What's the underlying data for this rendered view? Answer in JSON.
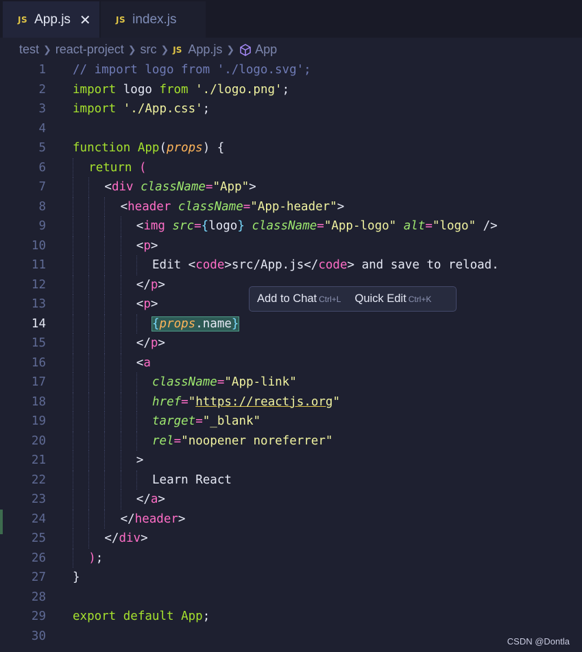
{
  "tabs": [
    {
      "icon": "JS",
      "label": "App.js",
      "active": true,
      "close": "✕"
    },
    {
      "icon": "JS",
      "label": "index.js",
      "active": false
    }
  ],
  "breadcrumb": {
    "items": [
      "test",
      "react-project",
      "src",
      "App.js",
      "App"
    ],
    "file_icon": "JS",
    "symbol_icon": "cube-icon"
  },
  "editor": {
    "current_line": 14,
    "modified_lines": [
      24
    ],
    "lines": [
      {
        "n": 1,
        "indent": 0,
        "tokens": [
          [
            "cm",
            "// import logo from './logo.svg';"
          ]
        ]
      },
      {
        "n": 2,
        "indent": 0,
        "tokens": [
          [
            "kw",
            "import"
          ],
          [
            "punc",
            " logo "
          ],
          [
            "kw",
            "from"
          ],
          [
            "punc",
            " "
          ],
          [
            "str",
            "'./logo.png'"
          ],
          [
            "punc",
            ";"
          ]
        ]
      },
      {
        "n": 3,
        "indent": 0,
        "tokens": [
          [
            "kw",
            "import"
          ],
          [
            "punc",
            " "
          ],
          [
            "str",
            "'./App.css'"
          ],
          [
            "punc",
            ";"
          ]
        ]
      },
      {
        "n": 4,
        "indent": 0,
        "tokens": []
      },
      {
        "n": 5,
        "indent": 0,
        "tokens": [
          [
            "kw",
            "function"
          ],
          [
            "punc",
            " "
          ],
          [
            "fn",
            "App"
          ],
          [
            "punc",
            "("
          ],
          [
            "param",
            "props"
          ],
          [
            "punc",
            ") {"
          ]
        ]
      },
      {
        "n": 6,
        "indent": 1,
        "tokens": [
          [
            "kw",
            "return"
          ],
          [
            "punc",
            " "
          ],
          [
            "paren",
            "("
          ]
        ]
      },
      {
        "n": 7,
        "indent": 2,
        "tokens": [
          [
            "punc",
            "<"
          ],
          [
            "tag",
            "div"
          ],
          [
            "punc",
            " "
          ],
          [
            "attr",
            "className"
          ],
          [
            "op",
            "="
          ],
          [
            "str",
            "\"App\""
          ],
          [
            "punc",
            ">"
          ]
        ]
      },
      {
        "n": 8,
        "indent": 3,
        "tokens": [
          [
            "punc",
            "<"
          ],
          [
            "tag",
            "header"
          ],
          [
            "punc",
            " "
          ],
          [
            "attr",
            "className"
          ],
          [
            "op",
            "="
          ],
          [
            "str",
            "\"App-header\""
          ],
          [
            "punc",
            ">"
          ]
        ]
      },
      {
        "n": 9,
        "indent": 4,
        "tokens": [
          [
            "punc",
            "<"
          ],
          [
            "tag",
            "img"
          ],
          [
            "punc",
            " "
          ],
          [
            "attr",
            "src"
          ],
          [
            "op",
            "="
          ],
          [
            "brace",
            "{"
          ],
          [
            "punc",
            "logo"
          ],
          [
            "brace",
            "}"
          ],
          [
            "punc",
            " "
          ],
          [
            "attr",
            "className"
          ],
          [
            "op",
            "="
          ],
          [
            "str",
            "\"App-logo\""
          ],
          [
            "punc",
            " "
          ],
          [
            "attr",
            "alt"
          ],
          [
            "op",
            "="
          ],
          [
            "str",
            "\"logo\""
          ],
          [
            "punc",
            " />"
          ]
        ]
      },
      {
        "n": 10,
        "indent": 4,
        "tokens": [
          [
            "punc",
            "<"
          ],
          [
            "tag",
            "p"
          ],
          [
            "punc",
            ">"
          ]
        ]
      },
      {
        "n": 11,
        "indent": 5,
        "tokens": [
          [
            "punc",
            "Edit <"
          ],
          [
            "tag",
            "code"
          ],
          [
            "punc",
            ">src/App.js</"
          ],
          [
            "tag",
            "code"
          ],
          [
            "punc",
            "> and save to reload."
          ]
        ]
      },
      {
        "n": 12,
        "indent": 4,
        "tokens": [
          [
            "punc",
            "</"
          ],
          [
            "tag",
            "p"
          ],
          [
            "punc",
            ">"
          ]
        ]
      },
      {
        "n": 13,
        "indent": 4,
        "tokens": [
          [
            "punc",
            "<"
          ],
          [
            "tag",
            "p"
          ],
          [
            "punc",
            ">"
          ]
        ]
      },
      {
        "n": 14,
        "indent": 5,
        "selected": true,
        "tokens": [
          [
            "brace",
            "{"
          ],
          [
            "param",
            "props"
          ],
          [
            "punc",
            ".name"
          ],
          [
            "brace",
            "}"
          ]
        ]
      },
      {
        "n": 15,
        "indent": 4,
        "tokens": [
          [
            "punc",
            "</"
          ],
          [
            "tag",
            "p"
          ],
          [
            "punc",
            ">"
          ]
        ]
      },
      {
        "n": 16,
        "indent": 4,
        "tokens": [
          [
            "punc",
            "<"
          ],
          [
            "tag",
            "a"
          ]
        ]
      },
      {
        "n": 17,
        "indent": 5,
        "tokens": [
          [
            "attr",
            "className"
          ],
          [
            "op",
            "="
          ],
          [
            "str",
            "\"App-link\""
          ]
        ]
      },
      {
        "n": 18,
        "indent": 5,
        "tokens": [
          [
            "attr",
            "href"
          ],
          [
            "op",
            "="
          ],
          [
            "str",
            "\""
          ],
          [
            "url",
            "https://reactjs.org"
          ],
          [
            "str",
            "\""
          ]
        ]
      },
      {
        "n": 19,
        "indent": 5,
        "tokens": [
          [
            "attr",
            "target"
          ],
          [
            "op",
            "="
          ],
          [
            "str",
            "\"_blank\""
          ]
        ]
      },
      {
        "n": 20,
        "indent": 5,
        "tokens": [
          [
            "attr",
            "rel"
          ],
          [
            "op",
            "="
          ],
          [
            "str",
            "\"noopener noreferrer\""
          ]
        ]
      },
      {
        "n": 21,
        "indent": 4,
        "tokens": [
          [
            "punc",
            ">"
          ]
        ]
      },
      {
        "n": 22,
        "indent": 5,
        "tokens": [
          [
            "punc",
            "Learn React"
          ]
        ]
      },
      {
        "n": 23,
        "indent": 4,
        "tokens": [
          [
            "punc",
            "</"
          ],
          [
            "tag",
            "a"
          ],
          [
            "punc",
            ">"
          ]
        ]
      },
      {
        "n": 24,
        "indent": 3,
        "tokens": [
          [
            "punc",
            "</"
          ],
          [
            "tag",
            "header"
          ],
          [
            "punc",
            ">"
          ]
        ]
      },
      {
        "n": 25,
        "indent": 2,
        "tokens": [
          [
            "punc",
            "</"
          ],
          [
            "tag",
            "div"
          ],
          [
            "punc",
            ">"
          ]
        ]
      },
      {
        "n": 26,
        "indent": 1,
        "tokens": [
          [
            "paren",
            ")"
          ],
          [
            "punc",
            ";"
          ]
        ]
      },
      {
        "n": 27,
        "indent": 0,
        "tokens": [
          [
            "punc",
            "}"
          ]
        ]
      },
      {
        "n": 28,
        "indent": 0,
        "tokens": []
      },
      {
        "n": 29,
        "indent": 0,
        "tokens": [
          [
            "kw",
            "export"
          ],
          [
            "punc",
            " "
          ],
          [
            "kw",
            "default"
          ],
          [
            "punc",
            " "
          ],
          [
            "fn",
            "App"
          ],
          [
            "punc",
            ";"
          ]
        ]
      },
      {
        "n": 30,
        "indent": 0,
        "tokens": []
      }
    ]
  },
  "popup": {
    "add_to_chat": "Add to Chat",
    "add_to_chat_shortcut": "Ctrl+L",
    "quick_edit": "Quick Edit",
    "quick_edit_shortcut": "Ctrl+K"
  },
  "watermark": "CSDN @Dontla",
  "colors": {
    "background": "#1e2030",
    "tabbar": "#191a27",
    "keyword": "#a6e22e",
    "string": "#f1f3a0",
    "tag": "#ff6ec7",
    "attribute": "#9ee86f",
    "parameter": "#ffb55a",
    "comment": "#6f7bb5",
    "js_icon": "#e0c546"
  }
}
